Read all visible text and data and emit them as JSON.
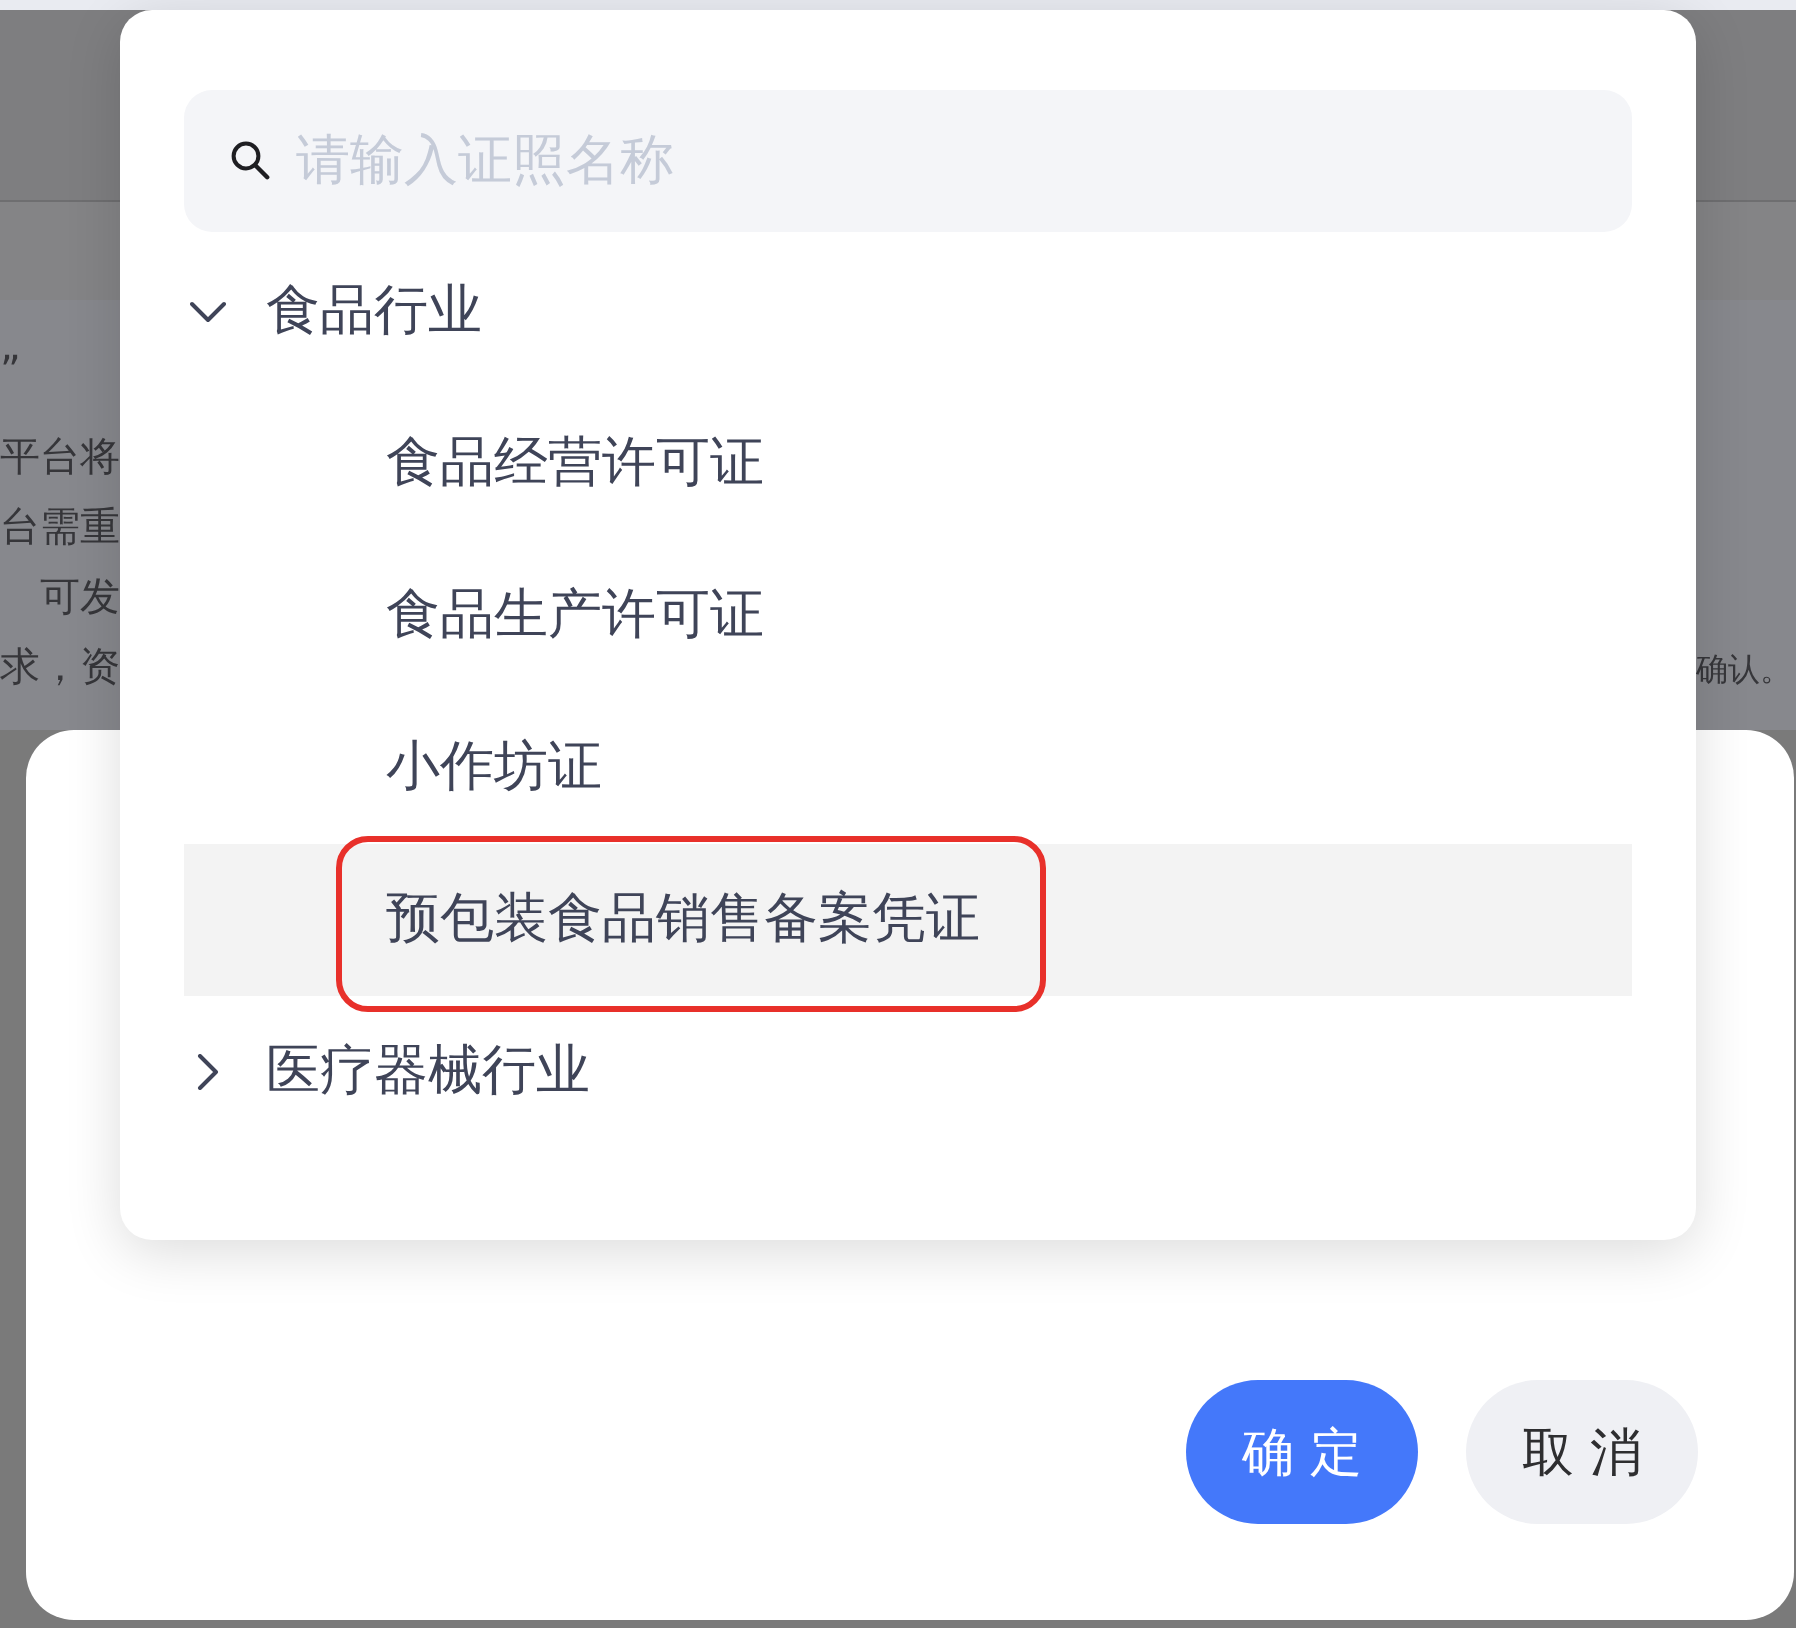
{
  "background_page": {
    "left_texts": [
      "”",
      "平台将",
      "台需重",
      "可发",
      "求，资"
    ],
    "right_text": "确认。"
  },
  "picker": {
    "search": {
      "placeholder": "请输入证照名称"
    },
    "tree": [
      {
        "label": "食品行业",
        "expanded": true,
        "selected": false,
        "children": [
          {
            "label": "食品经营许可证",
            "selected": false,
            "annotated": false
          },
          {
            "label": "食品生产许可证",
            "selected": false,
            "annotated": false
          },
          {
            "label": "小作坊证",
            "selected": false,
            "annotated": false
          },
          {
            "label": "预包装食品销售备案凭证",
            "selected": true,
            "annotated": true
          }
        ]
      },
      {
        "label": "医疗器械行业",
        "expanded": false,
        "selected": false
      }
    ]
  },
  "dialog": {
    "buttons": [
      {
        "label": "确 定",
        "kind": "primary"
      },
      {
        "label": "取 消",
        "kind": "secondary"
      }
    ]
  }
}
